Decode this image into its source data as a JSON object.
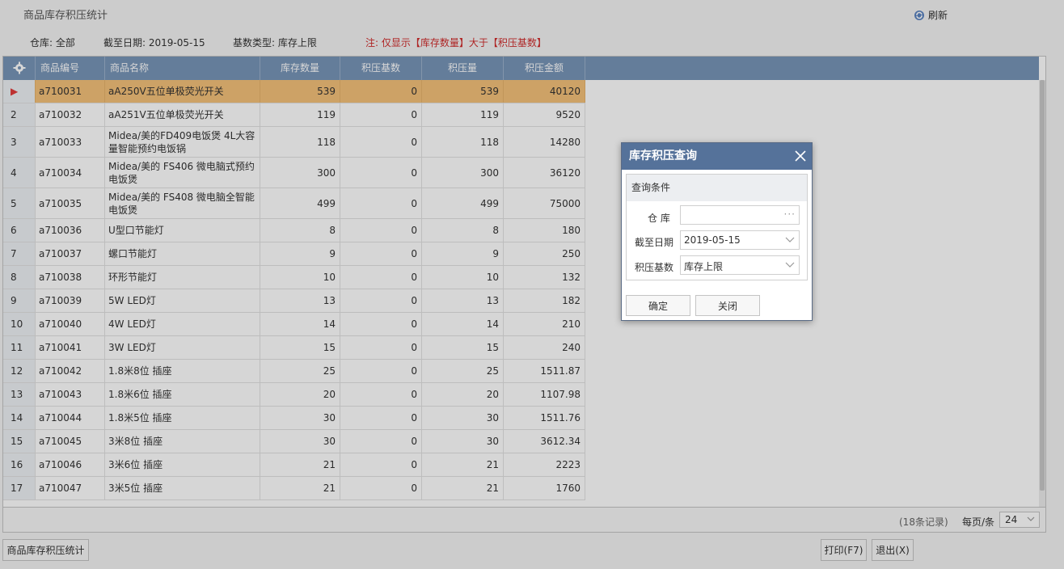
{
  "page_title": "商品库存积压统计",
  "refresh_label": "刷新",
  "filters": {
    "warehouse": "仓库:  全部",
    "date": "截至日期:  2019-05-15",
    "base_type": "基数类型:  库存上限",
    "note": "注:  仅显示【库存数量】大于【积压基数】"
  },
  "table": {
    "columns": [
      "商品编号",
      "商品名称",
      "库存数量",
      "积压基数",
      "积压量",
      "积压金额"
    ],
    "rows": [
      {
        "idx": "▶",
        "code": "a710031",
        "name": "aA250V五位单极荧光开关",
        "qty": "539",
        "base": "0",
        "over": "539",
        "amount": "40120"
      },
      {
        "idx": "2",
        "code": "a710032",
        "name": "aA251V五位单极荧光开关",
        "qty": "119",
        "base": "0",
        "over": "119",
        "amount": "9520"
      },
      {
        "idx": "3",
        "code": "a710033",
        "name": "Midea/美的FD409电饭煲 4L大容量智能预约电饭锅",
        "qty": "118",
        "base": "0",
        "over": "118",
        "amount": "14280"
      },
      {
        "idx": "4",
        "code": "a710034",
        "name": "Midea/美的 FS406 微电脑式预约电饭煲",
        "qty": "300",
        "base": "0",
        "over": "300",
        "amount": "36120"
      },
      {
        "idx": "5",
        "code": "a710035",
        "name": "Midea/美的 FS408 微电脑全智能电饭煲",
        "qty": "499",
        "base": "0",
        "over": "499",
        "amount": "75000"
      },
      {
        "idx": "6",
        "code": "a710036",
        "name": "U型口节能灯",
        "qty": "8",
        "base": "0",
        "over": "8",
        "amount": "180"
      },
      {
        "idx": "7",
        "code": "a710037",
        "name": "螺口节能灯",
        "qty": "9",
        "base": "0",
        "over": "9",
        "amount": "250"
      },
      {
        "idx": "8",
        "code": "a710038",
        "name": "环形节能灯",
        "qty": "10",
        "base": "0",
        "over": "10",
        "amount": "132"
      },
      {
        "idx": "9",
        "code": "a710039",
        "name": "5W LED灯",
        "qty": "13",
        "base": "0",
        "over": "13",
        "amount": "182"
      },
      {
        "idx": "10",
        "code": "a710040",
        "name": "4W LED灯",
        "qty": "14",
        "base": "0",
        "over": "14",
        "amount": "210"
      },
      {
        "idx": "11",
        "code": "a710041",
        "name": "3W LED灯",
        "qty": "15",
        "base": "0",
        "over": "15",
        "amount": "240"
      },
      {
        "idx": "12",
        "code": "a710042",
        "name": "1.8米8位 插座",
        "qty": "25",
        "base": "0",
        "over": "25",
        "amount": "1511.87"
      },
      {
        "idx": "13",
        "code": "a710043",
        "name": "1.8米6位 插座",
        "qty": "20",
        "base": "0",
        "over": "20",
        "amount": "1107.98"
      },
      {
        "idx": "14",
        "code": "a710044",
        "name": "1.8米5位 插座",
        "qty": "30",
        "base": "0",
        "over": "30",
        "amount": "1511.76"
      },
      {
        "idx": "15",
        "code": "a710045",
        "name": "3米8位 插座",
        "qty": "30",
        "base": "0",
        "over": "30",
        "amount": "3612.34"
      },
      {
        "idx": "16",
        "code": "a710046",
        "name": "3米6位 插座",
        "qty": "21",
        "base": "0",
        "over": "21",
        "amount": "2223"
      },
      {
        "idx": "17",
        "code": "a710047",
        "name": "3米5位 插座",
        "qty": "21",
        "base": "0",
        "over": "21",
        "amount": "1760"
      }
    ]
  },
  "footer": {
    "record_count": "(18条记录)",
    "per_page_label": "每页/条",
    "per_page_value": "24"
  },
  "bottom": {
    "tab_label": "商品库存积压统计",
    "print_label": "打印(F7)",
    "exit_label": "退出(X)"
  },
  "dialog": {
    "title": "库存积压查询",
    "section": "查询条件",
    "warehouse_label": "仓 库",
    "warehouse_value": "",
    "date_label": "截至日期",
    "date_value": "2019-05-15",
    "base_label": "积压基数",
    "base_value": "库存上限",
    "ok_label": "确定",
    "close_label": "关闭"
  },
  "colors": {
    "header_bg": "#7895b8",
    "selected_row": "#f5c17a",
    "dialog_head": "#55729a",
    "note": "#d02c2c"
  }
}
